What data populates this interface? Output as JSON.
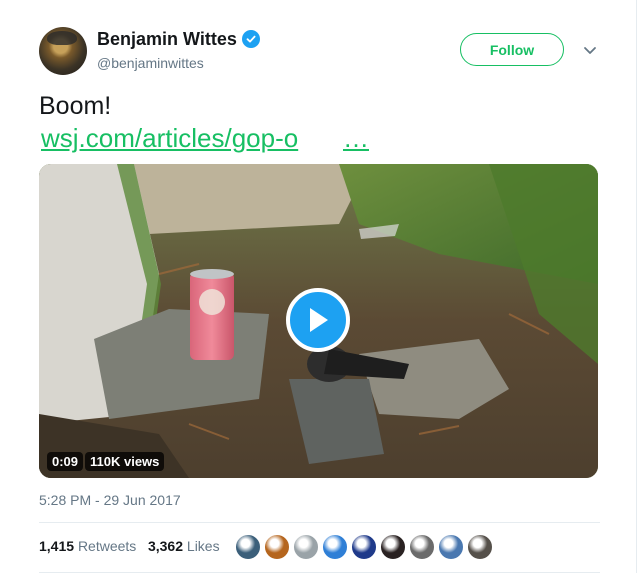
{
  "author": {
    "display_name": "Benjamin Wittes",
    "handle": "@benjaminwittes",
    "verified": true,
    "follow_label": "Follow"
  },
  "tweet": {
    "text": "Boom!",
    "link_text": "wsj.com/articles/gop-o",
    "link_more": "…"
  },
  "video": {
    "duration": "0:09",
    "views": "110K views"
  },
  "meta": {
    "timestamp": "5:28 PM - 29 Jun 2017"
  },
  "stats": {
    "retweets_count": "1,415",
    "retweets_label": "Retweets",
    "likes_count": "3,362",
    "likes_label": "Likes"
  },
  "likers": [
    {
      "name": "liker-avatar-1",
      "color": "#3b5f7a"
    },
    {
      "name": "liker-avatar-2",
      "color": "#b5651d"
    },
    {
      "name": "liker-avatar-3",
      "color": "#9aa3a8"
    },
    {
      "name": "liker-avatar-4",
      "color": "#2f7fd6"
    },
    {
      "name": "liker-avatar-5",
      "color": "#1f3a8a"
    },
    {
      "name": "liker-avatar-6",
      "color": "#2a2222"
    },
    {
      "name": "liker-avatar-7",
      "color": "#6b6b6b"
    },
    {
      "name": "liker-avatar-8",
      "color": "#4a78b0"
    },
    {
      "name": "liker-avatar-9",
      "color": "#55504a"
    }
  ],
  "colors": {
    "accent_green": "#17bf63",
    "verified_blue": "#1da1f2",
    "muted": "#657786"
  }
}
